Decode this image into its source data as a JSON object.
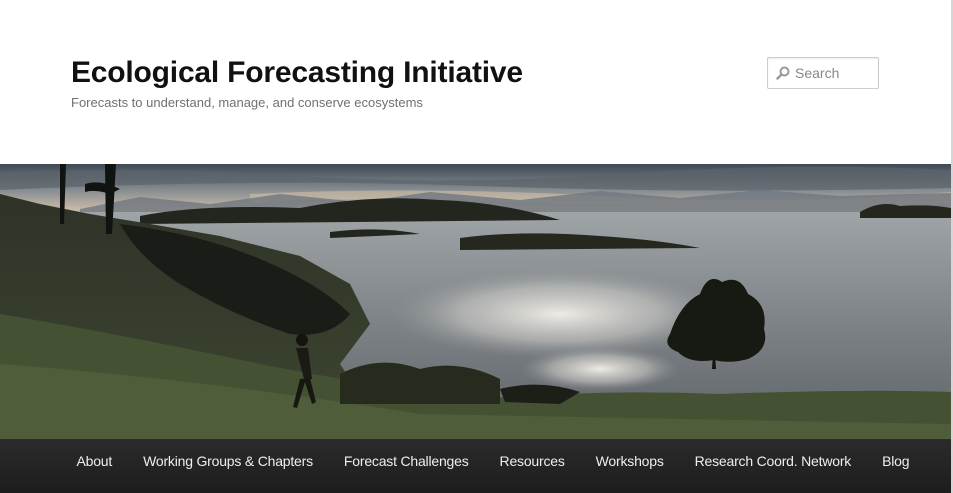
{
  "site": {
    "title": "Ecological Forecasting Initiative",
    "tagline": "Forecasts to understand, manage, and conserve ecosystems"
  },
  "search": {
    "placeholder": "Search",
    "icon": "search-icon"
  },
  "header_image": {
    "subject": "coastal-landscape-photo"
  },
  "nav": {
    "items": [
      {
        "label": "About"
      },
      {
        "label": "Working Groups & Chapters"
      },
      {
        "label": "Forecast Challenges"
      },
      {
        "label": "Resources"
      },
      {
        "label": "Workshops"
      },
      {
        "label": "Research Coord. Network"
      },
      {
        "label": "Blog"
      }
    ]
  },
  "colors": {
    "title": "#111111",
    "tagline": "#707070",
    "nav_background": "#222222",
    "nav_text": "#eeeeee"
  }
}
